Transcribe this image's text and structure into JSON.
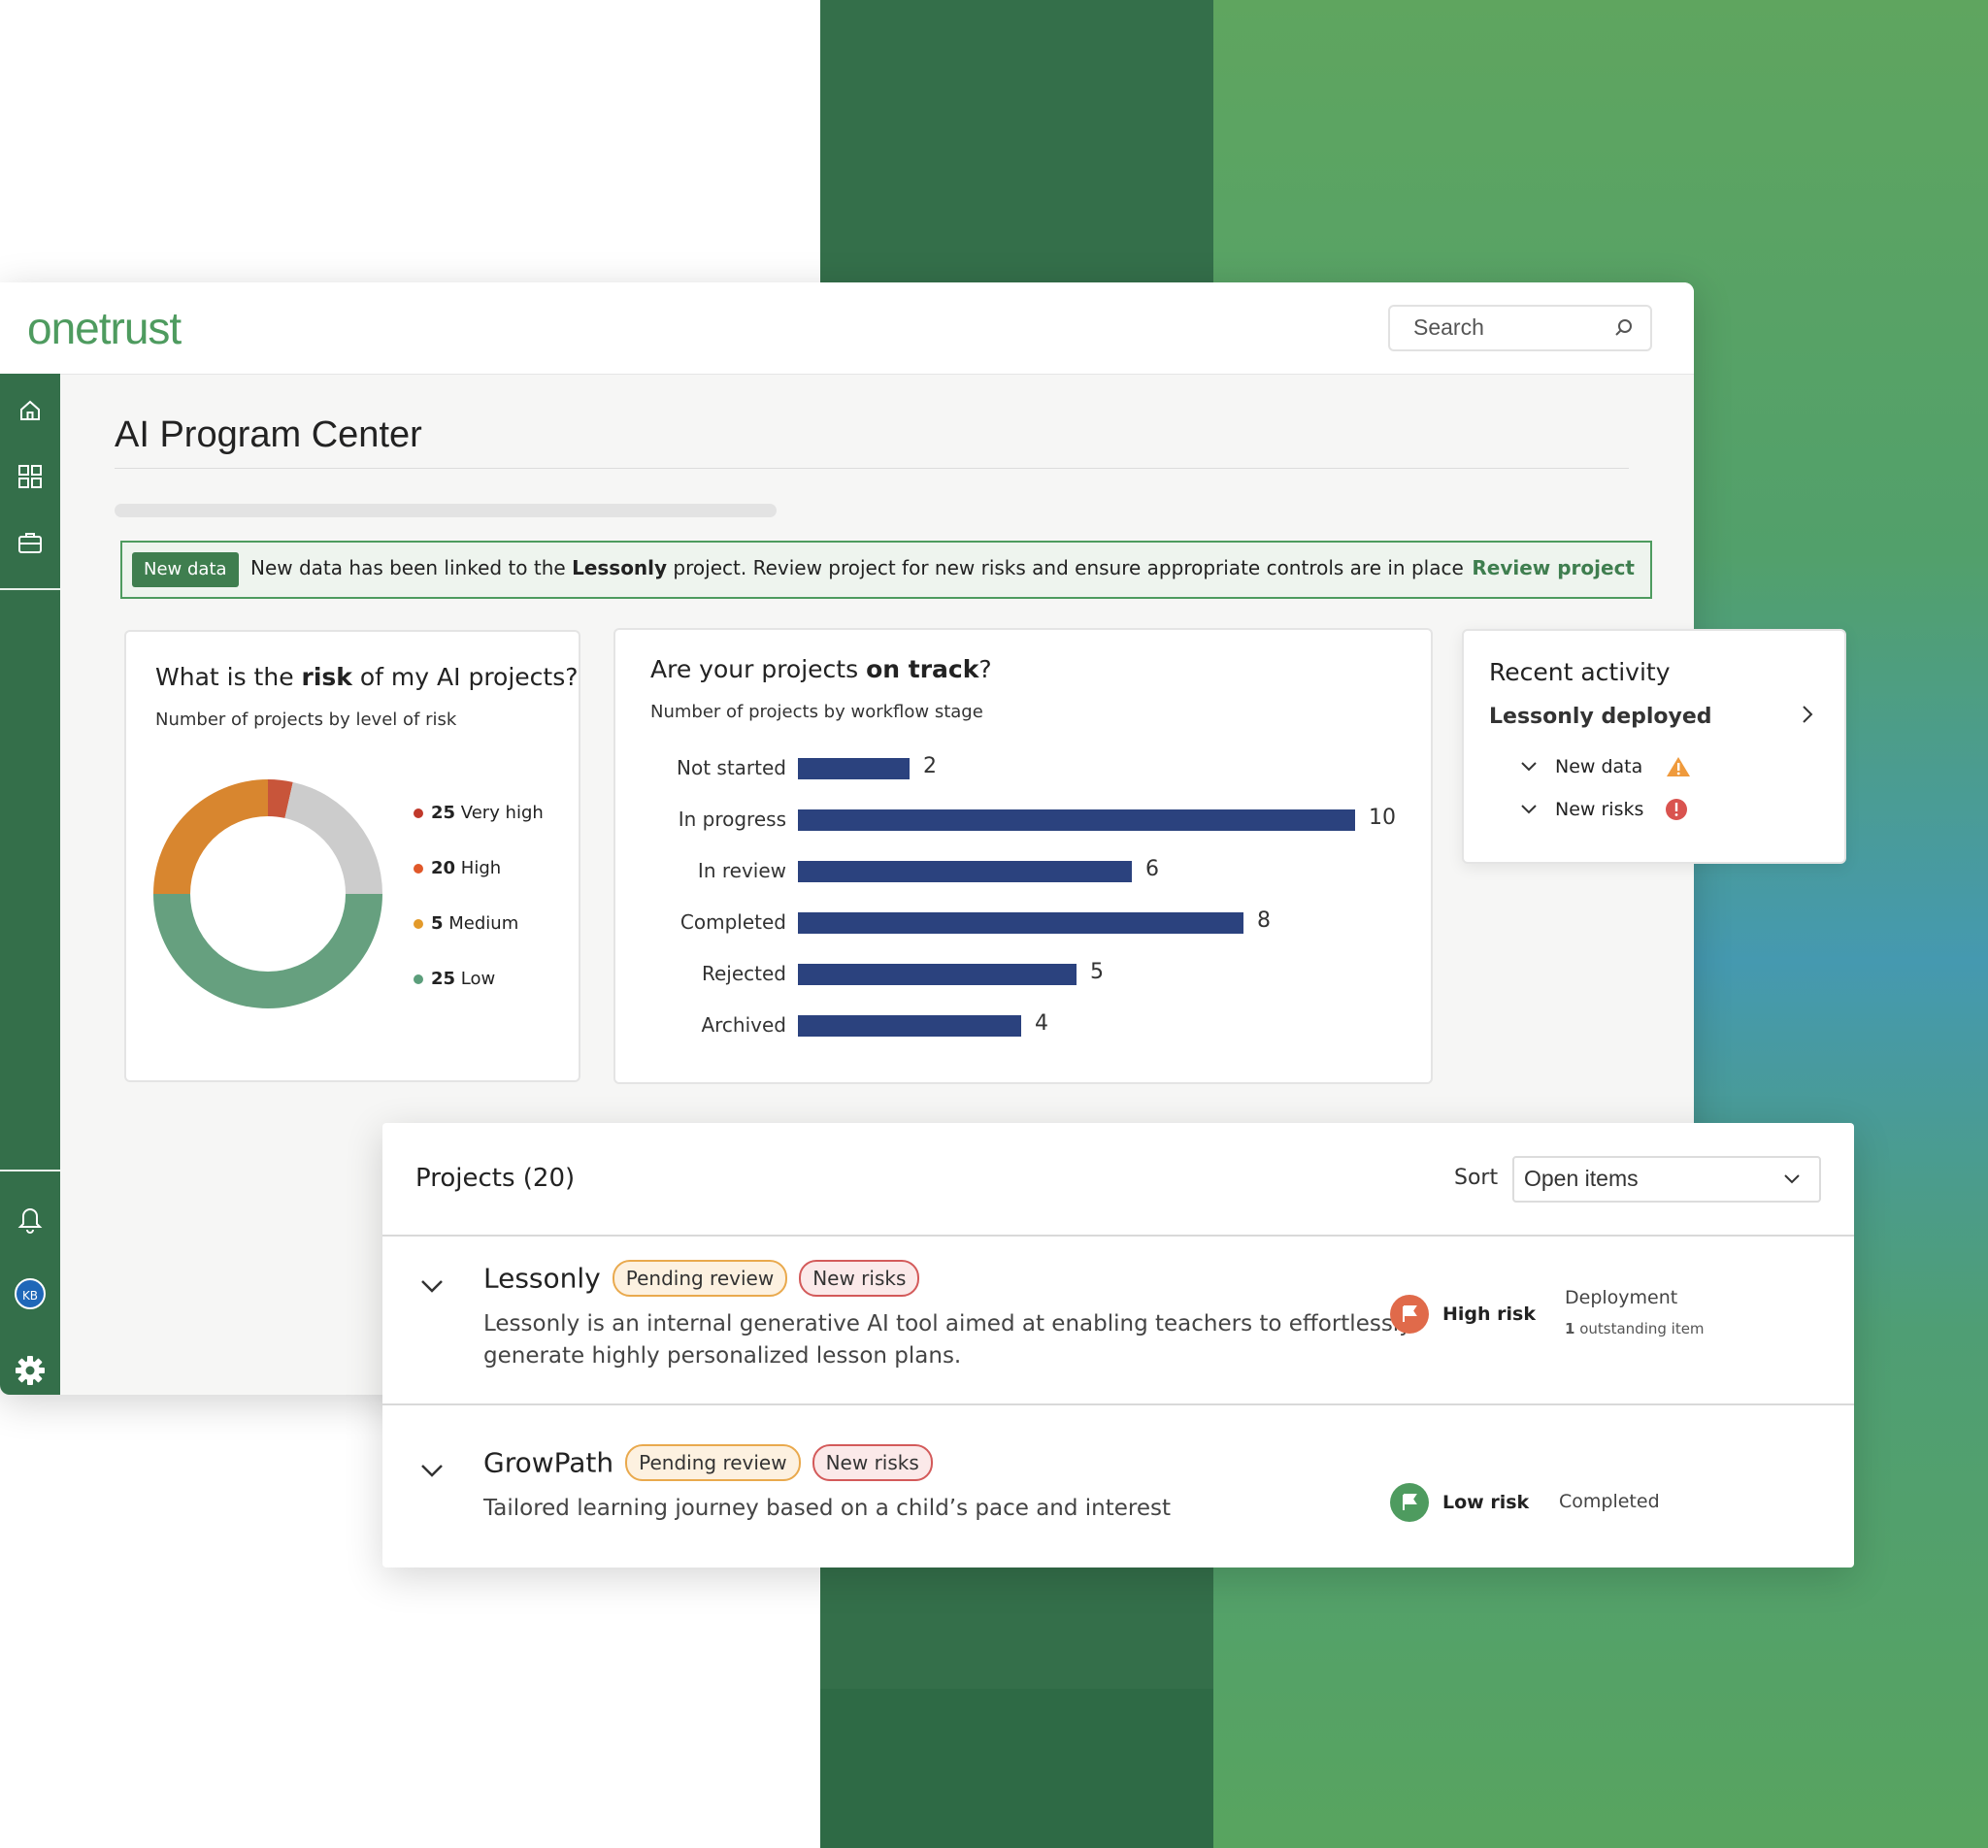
{
  "brand": {
    "logo_text": "onetrust"
  },
  "search": {
    "placeholder": "Search"
  },
  "page": {
    "title": "AI Program Center"
  },
  "banner": {
    "tag": "New data",
    "text_before": "New data has been linked to the ",
    "text_bold": "Lessonly",
    "text_after": " project. Review project for new risks and ensure appropriate controls are in place",
    "link": "Review project"
  },
  "risk_card": {
    "title_before": "What is the ",
    "title_bold": "risk",
    "title_after": " of my AI projects?",
    "subtitle": "Number of projects by level of risk",
    "legend": [
      {
        "count": "25",
        "label": "Very high",
        "color": "#c0392b"
      },
      {
        "count": "20",
        "label": "High",
        "color": "#e0582a"
      },
      {
        "count": "5",
        "label": "Medium",
        "color": "#e39a2a"
      },
      {
        "count": "25",
        "label": "Low",
        "color": "#5b9e7b"
      }
    ]
  },
  "track_card": {
    "title_before": "Are your projects ",
    "title_bold": "on track",
    "title_after": "?",
    "subtitle": "Number of projects by workflow stage"
  },
  "chart_data": [
    {
      "type": "pie",
      "categories": [
        "Very high",
        "High",
        "Medium",
        "Low"
      ],
      "values": [
        25,
        20,
        5,
        25
      ],
      "colors": {
        "segments": [
          "#c8553a",
          "#d8862f",
          "#cccccc",
          "#66a07f"
        ]
      }
    },
    {
      "type": "bar",
      "orientation": "horizontal",
      "categories": [
        "Not started",
        "In progress",
        "In review",
        "Completed",
        "Rejected",
        "Archived"
      ],
      "values": [
        2,
        10,
        6,
        8,
        5,
        4
      ],
      "bar_color": "#2b427e"
    }
  ],
  "recent_activity": {
    "title": "Recent activity",
    "item": "Lessonly deployed",
    "sub_items": [
      {
        "label": "New data",
        "icon": "warning-icon"
      },
      {
        "label": "New risks",
        "icon": "alert-icon"
      }
    ]
  },
  "projects": {
    "title": "Projects (20)",
    "sort_label": "Sort",
    "sort_value": "Open items",
    "rows": [
      {
        "name": "Lessonly",
        "tags": [
          "Pending review",
          "New risks"
        ],
        "description_line1": "Lessonly is an internal generative AI tool aimed at enabling teachers to effortlessly",
        "description_line2": "generate highly personalized lesson plans.",
        "risk": "High risk",
        "risk_color": "#e06a4a",
        "stage": "Deployment",
        "stage_note_count": "1",
        "stage_note": " outstanding item"
      },
      {
        "name": "GrowPath",
        "tags": [
          "Pending review",
          "New risks"
        ],
        "description_line1": "Tailored learning journey based on a child’s pace and interest",
        "description_line2": "",
        "risk": "Low risk",
        "risk_color": "#4e9b5f",
        "stage": "Completed",
        "stage_note_count": "",
        "stage_note": ""
      }
    ]
  },
  "sidebar": {
    "avatar_initials": "KB"
  }
}
